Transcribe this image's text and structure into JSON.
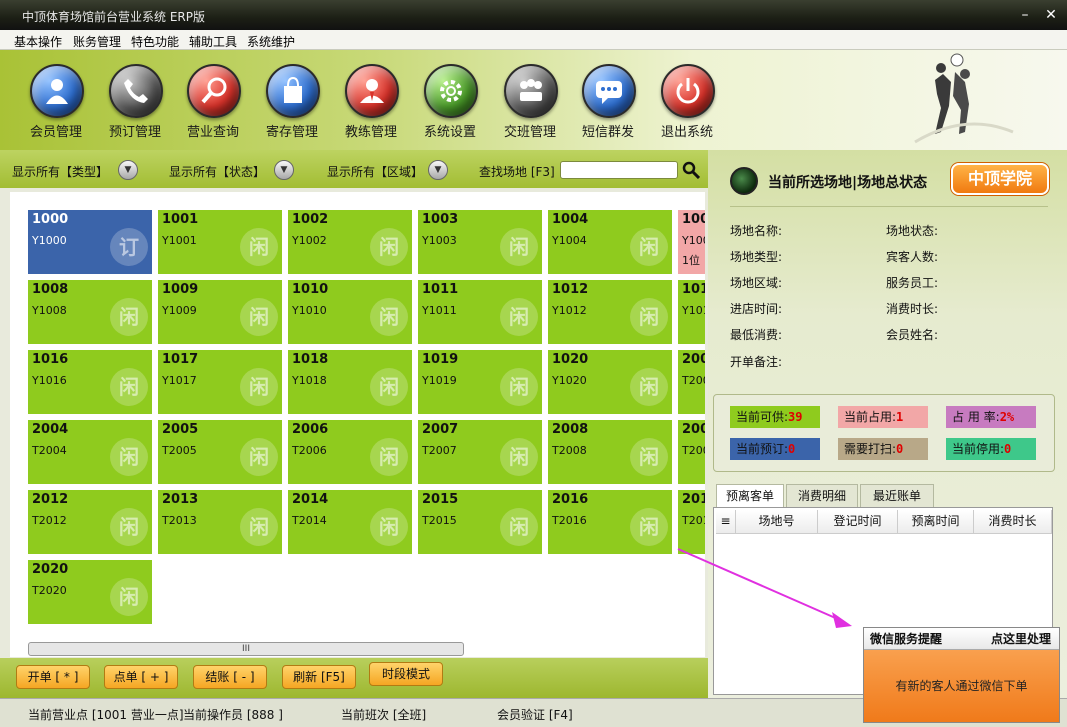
{
  "window": {
    "title": "中顶体育场馆前台营业系统 ERP版",
    "min_icon": "minimize-icon",
    "close_icon": "close-icon"
  },
  "menu": [
    "基本操作",
    "账务管理",
    "特色功能",
    "辅助工具",
    "系统维护"
  ],
  "toolbar": [
    {
      "label": "会员管理",
      "icon": "member-icon",
      "color": "#2f6fd0"
    },
    {
      "label": "预订管理",
      "icon": "phone-icon",
      "color": "#5a5a5a"
    },
    {
      "label": "营业查询",
      "icon": "magnifier-icon",
      "color": "#d8332b"
    },
    {
      "label": "寄存管理",
      "icon": "bag-icon",
      "color": "#2f6fd0"
    },
    {
      "label": "教练管理",
      "icon": "coach-icon",
      "color": "#d8332b"
    },
    {
      "label": "系统设置",
      "icon": "gear-icon",
      "color": "#4b9b2a"
    },
    {
      "label": "交班管理",
      "icon": "handover-icon",
      "color": "#5a5a5a"
    },
    {
      "label": "短信群发",
      "icon": "message-icon",
      "color": "#2f6fd0"
    },
    {
      "label": "退出系统",
      "icon": "power-icon",
      "color": "#d8332b"
    }
  ],
  "filters": {
    "type": "显示所有【类型】",
    "status": "显示所有【状态】",
    "area": "显示所有【区域】",
    "search_label": "查找场地 [F3]",
    "search_value": ""
  },
  "venues": [
    {
      "num": "1000",
      "code": "Y1000",
      "state": "blue",
      "badge": "订"
    },
    {
      "num": "1001",
      "code": "Y1001",
      "state": "free",
      "badge": "闲"
    },
    {
      "num": "1002",
      "code": "Y1002",
      "state": "free",
      "badge": "闲"
    },
    {
      "num": "1003",
      "code": "Y1003",
      "state": "free",
      "badge": "闲"
    },
    {
      "num": "1004",
      "code": "Y1004",
      "state": "free",
      "badge": "闲"
    },
    {
      "num": "100",
      "code": "Y100",
      "state": "pink",
      "badge": "",
      "extra": "1位"
    },
    {
      "num": "1008",
      "code": "Y1008",
      "state": "free",
      "badge": "闲"
    },
    {
      "num": "1009",
      "code": "Y1009",
      "state": "free",
      "badge": "闲"
    },
    {
      "num": "1010",
      "code": "Y1010",
      "state": "free",
      "badge": "闲"
    },
    {
      "num": "1011",
      "code": "Y1011",
      "state": "free",
      "badge": "闲"
    },
    {
      "num": "1012",
      "code": "Y1012",
      "state": "free",
      "badge": "闲"
    },
    {
      "num": "101",
      "code": "Y101",
      "state": "free",
      "badge": ""
    },
    {
      "num": "1016",
      "code": "Y1016",
      "state": "free",
      "badge": "闲"
    },
    {
      "num": "1017",
      "code": "Y1017",
      "state": "free",
      "badge": "闲"
    },
    {
      "num": "1018",
      "code": "Y1018",
      "state": "free",
      "badge": "闲"
    },
    {
      "num": "1019",
      "code": "Y1019",
      "state": "free",
      "badge": "闲"
    },
    {
      "num": "1020",
      "code": "Y1020",
      "state": "free",
      "badge": "闲"
    },
    {
      "num": "200",
      "code": "T200",
      "state": "free",
      "badge": ""
    },
    {
      "num": "2004",
      "code": "T2004",
      "state": "free",
      "badge": "闲"
    },
    {
      "num": "2005",
      "code": "T2005",
      "state": "free",
      "badge": "闲"
    },
    {
      "num": "2006",
      "code": "T2006",
      "state": "free",
      "badge": "闲"
    },
    {
      "num": "2007",
      "code": "T2007",
      "state": "free",
      "badge": "闲"
    },
    {
      "num": "2008",
      "code": "T2008",
      "state": "free",
      "badge": "闲"
    },
    {
      "num": "200",
      "code": "T200",
      "state": "free",
      "badge": ""
    },
    {
      "num": "2012",
      "code": "T2012",
      "state": "free",
      "badge": "闲"
    },
    {
      "num": "2013",
      "code": "T2013",
      "state": "free",
      "badge": "闲"
    },
    {
      "num": "2014",
      "code": "T2014",
      "state": "free",
      "badge": "闲"
    },
    {
      "num": "2015",
      "code": "T2015",
      "state": "free",
      "badge": "闲"
    },
    {
      "num": "2016",
      "code": "T2016",
      "state": "free",
      "badge": "闲"
    },
    {
      "num": "201",
      "code": "T201",
      "state": "free",
      "badge": ""
    },
    {
      "num": "2020",
      "code": "T2020",
      "state": "free",
      "badge": "闲"
    }
  ],
  "scroll_handle": "III",
  "actions": [
    "开单 [ * ]",
    "点单 [ + ]",
    "结账 [ - ]",
    "刷新 [F5]",
    "时段模式"
  ],
  "status": {
    "point": "当前营业点 [1001 营业一点]",
    "operator": "当前操作员 [888 ]",
    "shift": "当前班次 [全班]",
    "verify": "会员验证 [F4]"
  },
  "panel": {
    "title": "当前所选场地|场地总状态",
    "logo": "中顶学院",
    "left_fields": [
      "场地名称:",
      "场地类型:",
      "场地区域:",
      "进店时间:",
      "最低消费:",
      "开单备注:"
    ],
    "right_fields": [
      "场地状态:",
      "宾客人数:",
      "服务员工:",
      "消费时长:",
      "会员姓名:"
    ],
    "stats": [
      {
        "label": "当前可供:",
        "value": "39",
        "color": "#8fcb1e"
      },
      {
        "label": "当前占用:",
        "value": "1",
        "color": "#f2a7a7"
      },
      {
        "label": "占 用 率:",
        "value": "2%",
        "color": "#c77bc0"
      },
      {
        "label": "当前预订:",
        "value": "0",
        "color": "#3b64aa"
      },
      {
        "label": "需要打扫:",
        "value": "0",
        "color": "#b8a888"
      },
      {
        "label": "当前停用:",
        "value": "0",
        "color": "#3ec88a"
      }
    ],
    "tabs": [
      "预离客单",
      "消费明细",
      "最近账单"
    ],
    "columns": [
      "场地号",
      "登记时间",
      "预离时间",
      "消费时长"
    ]
  },
  "wechat": {
    "title": "微信服务提醒",
    "action": "点这里处理",
    "message": "有新的客人通过微信下单"
  }
}
